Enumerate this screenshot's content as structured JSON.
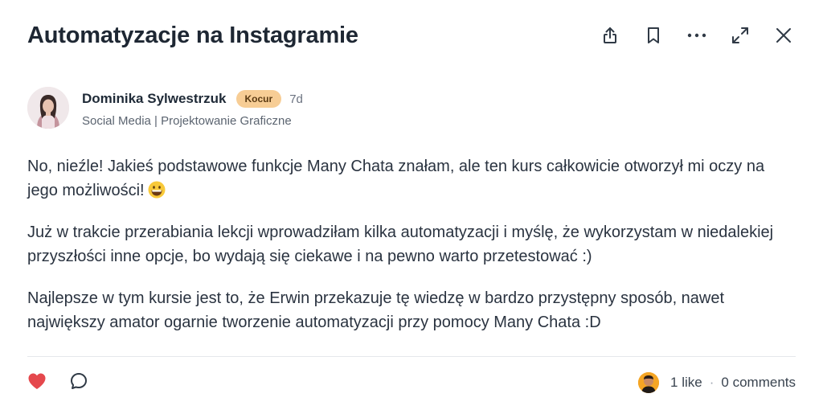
{
  "post": {
    "title": "Automatyzacje na Instagramie",
    "author": {
      "name": "Dominika Sylwestrzuk",
      "badge": "Kocur",
      "time": "7d",
      "category": "Social Media | Projektowanie Graficzne"
    },
    "paragraphs": [
      "No, nieźle! Jakieś podstawowe funkcje Many Chata znałam, ale ten kurs całkowicie otworzył mi oczy na jego możliwości!",
      "Już w trakcie przerabiania lekcji wprowadziłam kilka automatyzacji i myślę, że wykorzystam w niedalekiej przyszłości inne opcje, bo wydają się ciekawe i na pewno warto przetestować :)",
      "Najlepsze w tym kursie jest to, że Erwin przekazuje tę wiedzę w bardzo przystępny sposób, nawet największy amator ogarnie tworzenie automatyzacji przy pomocy Many Chata :D"
    ],
    "likes_text": "1 like",
    "separator": "·",
    "comments_text": "0 comments"
  },
  "icons": {
    "share": "share-icon",
    "bookmark": "bookmark-icon",
    "more": "more-icon",
    "expand": "expand-icon",
    "close": "close-icon",
    "like": "heart-icon",
    "comment": "comment-icon",
    "emoji": "grinning-emoji-icon"
  },
  "colors": {
    "badge_bg": "#f7cd95",
    "heart": "#e5484d",
    "title": "#1e2733"
  }
}
